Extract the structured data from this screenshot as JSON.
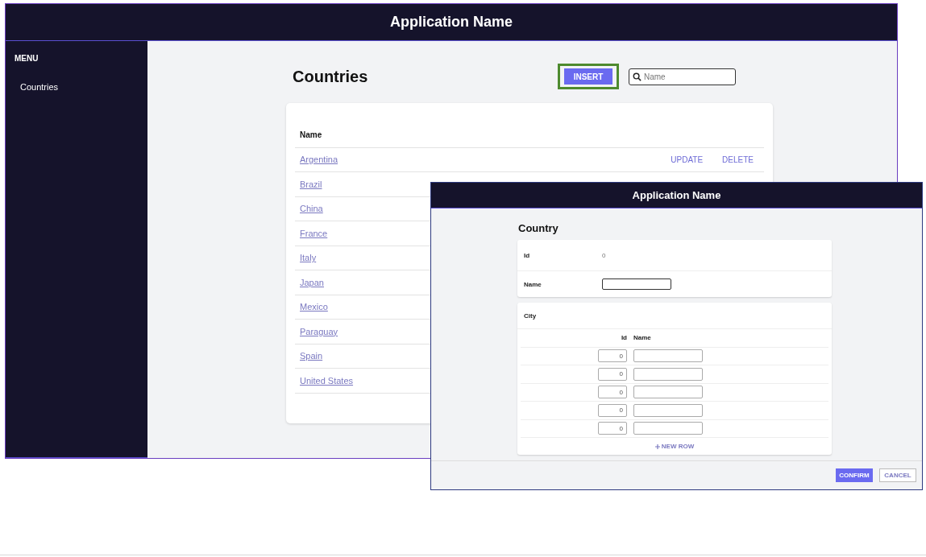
{
  "main_window": {
    "header": {
      "title": "Application Name"
    },
    "sidebar": {
      "heading": "MENU",
      "items": [
        {
          "label": "Countries"
        }
      ]
    },
    "page_title": "Countries",
    "insert_button": {
      "label": "INSERT",
      "focused": true
    },
    "search": {
      "placeholder": "Name"
    },
    "table": {
      "columns": [
        "Name"
      ],
      "rows": [
        {
          "name": "Argentina",
          "actions": [
            "UPDATE",
            "DELETE"
          ]
        },
        {
          "name": "Brazil"
        },
        {
          "name": "China"
        },
        {
          "name": "France"
        },
        {
          "name": "Italy"
        },
        {
          "name": "Japan"
        },
        {
          "name": "Mexico"
        },
        {
          "name": "Paraguay"
        },
        {
          "name": "Spain"
        },
        {
          "name": "United States"
        }
      ]
    }
  },
  "dialog": {
    "header": {
      "title": "Application Name"
    },
    "title": "Country",
    "fields": [
      {
        "label": "Id",
        "kind": "readonly",
        "value": "0"
      },
      {
        "label": "Name",
        "kind": "input"
      }
    ],
    "city": {
      "title": "City",
      "columns": [
        "Id",
        "Name"
      ],
      "rows": [
        {
          "id": "0"
        },
        {
          "id": "0"
        },
        {
          "id": "0"
        },
        {
          "id": "0"
        },
        {
          "id": "0"
        }
      ],
      "new_row": "NEW ROW"
    },
    "buttons": [
      {
        "label": "CONFIRM",
        "kind": "primary"
      },
      {
        "label": "CANCEL",
        "kind": "secondary"
      }
    ]
  }
}
